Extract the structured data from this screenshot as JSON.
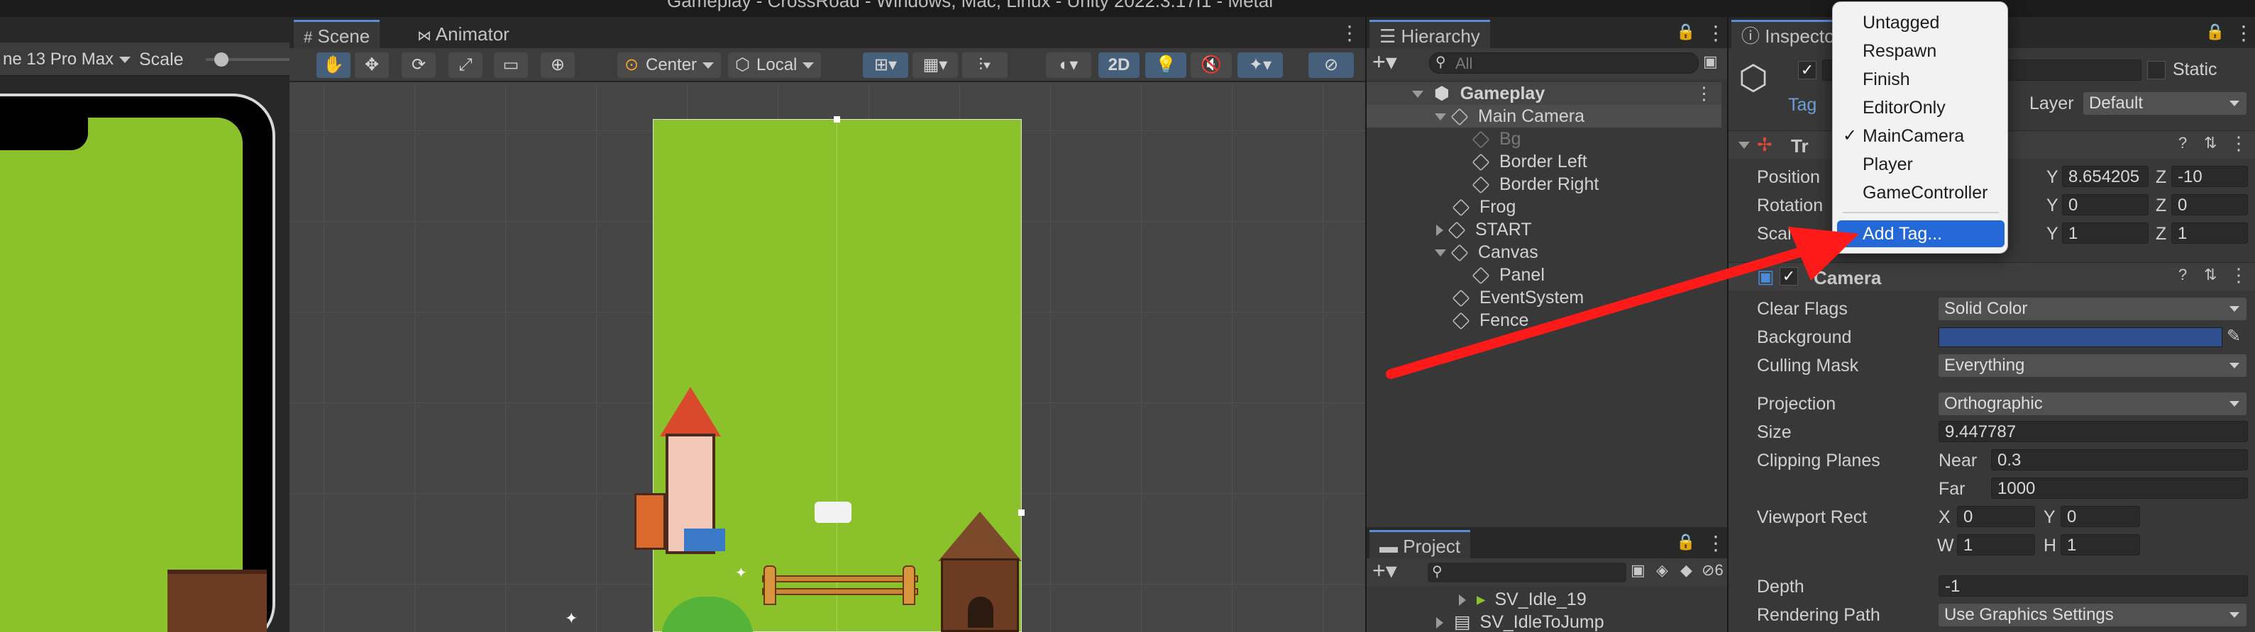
{
  "window_title": "Gameplay - CrossRoad - Windows, Mac, Linux - Unity 2022.3.17f1 - Metal",
  "game_view": {
    "device_label": "ne 13 Pro Max",
    "scale_label": "Scale"
  },
  "scene": {
    "tabs": [
      {
        "label": "Scene"
      },
      {
        "label": "Animator"
      }
    ],
    "pivot": "Center",
    "space": "Local",
    "mode_2d": "2D"
  },
  "hierarchy": {
    "tab": "Hierarchy",
    "search_placeholder": "All",
    "items": [
      {
        "label": "Gameplay",
        "depth": 0,
        "type": "scene"
      },
      {
        "label": "Main Camera",
        "depth": 1,
        "type": "expanded",
        "selected": true
      },
      {
        "label": "Bg",
        "depth": 2,
        "type": "leaf",
        "dim": true
      },
      {
        "label": "Border Left",
        "depth": 2,
        "type": "leaf"
      },
      {
        "label": "Border Right",
        "depth": 2,
        "type": "leaf"
      },
      {
        "label": "Frog",
        "depth": 1,
        "type": "leaf"
      },
      {
        "label": "START",
        "depth": 1,
        "type": "collapsed"
      },
      {
        "label": "Canvas",
        "depth": 1,
        "type": "expanded"
      },
      {
        "label": "Panel",
        "depth": 2,
        "type": "leaf"
      },
      {
        "label": "EventSystem",
        "depth": 1,
        "type": "leaf"
      },
      {
        "label": "Fence",
        "depth": 1,
        "type": "leaf"
      }
    ]
  },
  "project": {
    "tab": "Project",
    "hidden_count": "6",
    "items": [
      {
        "label": "SV_Idle_19"
      },
      {
        "label": "SV_IdleToJump"
      }
    ]
  },
  "inspector": {
    "tab": "Inspecto",
    "static_label": "Static",
    "tag_label": "Tag",
    "layer_label": "Layer",
    "layer_value": "Default",
    "transform": {
      "title": "Tr",
      "position_label": "Position",
      "rotation_label": "Rotation",
      "scale_label": "Scale",
      "pos_y": "8.654205",
      "pos_z": "-10",
      "rot_y": "0",
      "rot_z": "0",
      "scale_y": "1",
      "scale_z": "1"
    },
    "camera": {
      "title": "Camera",
      "clear_flags_label": "Clear Flags",
      "clear_flags": "Solid Color",
      "background_label": "Background",
      "culling_mask_label": "Culling Mask",
      "culling_mask": "Everything",
      "projection_label": "Projection",
      "projection": "Orthographic",
      "size_label": "Size",
      "size": "9.447787",
      "clipping_label": "Clipping Planes",
      "near_label": "Near",
      "near": "0.3",
      "far_label": "Far",
      "far": "1000",
      "viewport_label": "Viewport Rect",
      "vx": "0",
      "vy": "0",
      "vw": "1",
      "vh": "1",
      "depth_label": "Depth",
      "depth": "-1",
      "rendering_path_label": "Rendering Path",
      "rendering_path": "Use Graphics Settings"
    }
  },
  "tag_menu": {
    "items": [
      {
        "label": "Untagged"
      },
      {
        "label": "Respawn"
      },
      {
        "label": "Finish"
      },
      {
        "label": "EditorOnly"
      },
      {
        "label": "MainCamera",
        "checked": true
      },
      {
        "label": "Player"
      },
      {
        "label": "GameController"
      },
      {
        "label": "Add Tag...",
        "highlighted": true
      }
    ]
  },
  "colors": {
    "accent": "#2467d6",
    "grass": "#8bc22b",
    "annotation_arrow": "#ff1a1a",
    "camera_bg": "#2f4f8f"
  }
}
